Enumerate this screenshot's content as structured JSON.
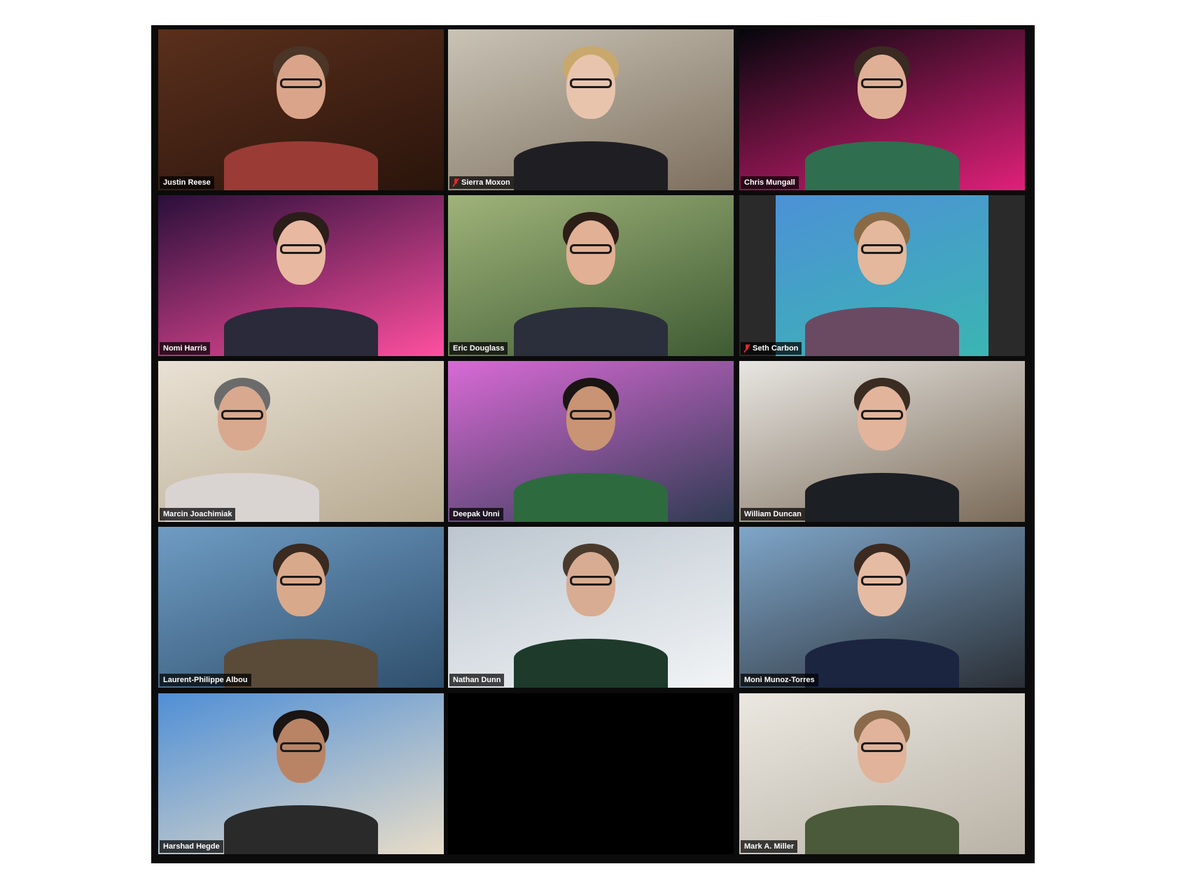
{
  "window": {
    "app": "video-conference-gallery-view"
  },
  "participants": [
    {
      "name": "Justin Reese",
      "muted": false,
      "background": "coffee-beans",
      "colors": {
        "bg1": "#5a2f1c",
        "bg2": "#2a140b",
        "shirt": "#9a3b36",
        "skin": "#d9a48a",
        "hair": "#4a3526"
      }
    },
    {
      "name": "Sierra Moxon",
      "muted": true,
      "background": "desert-outpost",
      "colors": {
        "bg1": "#c9c3b6",
        "bg2": "#7d6f5e",
        "shirt": "#1f1f23",
        "skin": "#e9c4ad",
        "hair": "#c9a86d"
      }
    },
    {
      "name": "Chris Mungall",
      "muted": false,
      "background": "neon-branches",
      "colors": {
        "bg1": "#05060c",
        "bg2": "#e0207a",
        "shirt": "#2f6e4e",
        "skin": "#e0b096",
        "hair": "#3a2a22"
      }
    },
    {
      "name": "Nomi Harris",
      "muted": false,
      "background": "lantern-room",
      "colors": {
        "bg1": "#2a0f3a",
        "bg2": "#ff4fa0",
        "shirt": "#2a2a3a",
        "skin": "#e8b9a0",
        "hair": "#2b1d1a"
      }
    },
    {
      "name": "Eric Douglass",
      "muted": false,
      "background": "punting-river",
      "colors": {
        "bg1": "#9fb37a",
        "bg2": "#3f5b33",
        "shirt": "#2b2f3c",
        "skin": "#e2b094",
        "hair": "#2c1e17"
      }
    },
    {
      "name": "Seth Carbon",
      "muted": true,
      "background": "tropical-sea",
      "colors": {
        "bg1": "#4d8fd8",
        "bg2": "#3ab7b0",
        "shirt": "#6a4a63",
        "skin": "#e3b89d",
        "hair": "#8a6a45",
        "frame": "#2a2a2a"
      }
    },
    {
      "name": "Marcin Joachimiak",
      "muted": false,
      "background": "living-room",
      "colors": {
        "bg1": "#e9e1d4",
        "bg2": "#b6a990",
        "shirt": "#d9d4d2",
        "skin": "#d8a98e",
        "hair": "#6b6b6b"
      }
    },
    {
      "name": "Deepak Unni",
      "muted": false,
      "background": "alpine-village",
      "colors": {
        "bg1": "#d96ad6",
        "bg2": "#2f3b52",
        "shirt": "#2d6b3f",
        "skin": "#c99474",
        "hair": "#1a1412"
      }
    },
    {
      "name": "William Duncan",
      "muted": false,
      "background": "home-office",
      "colors": {
        "bg1": "#e8e6e2",
        "bg2": "#7a6a58",
        "shirt": "#1c1f24",
        "skin": "#e2b49c",
        "hair": "#3b2c22"
      }
    },
    {
      "name": "Laurent-Philippe Albou",
      "muted": false,
      "background": "golden-gate-bridge",
      "colors": {
        "bg1": "#6f9cc4",
        "bg2": "#2f4f6c",
        "shirt": "#5a4a38",
        "skin": "#d9a98c",
        "hair": "#3a2a20"
      }
    },
    {
      "name": "Nathan Dunn",
      "muted": false,
      "background": "ski-slope",
      "colors": {
        "bg1": "#bcc6cf",
        "bg2": "#f2f4f6",
        "shirt": "#1d3a2a",
        "skin": "#d8ac92",
        "hair": "#4a3a2c"
      }
    },
    {
      "name": "Moni Munoz-Torres",
      "muted": false,
      "background": "window-balcony",
      "colors": {
        "bg1": "#7fa6c9",
        "bg2": "#2a2f36",
        "shirt": "#1c2540",
        "skin": "#e6bba3",
        "hair": "#3c2a20"
      }
    },
    {
      "name": "Harshad Hegde",
      "muted": false,
      "background": "palm-beach",
      "colors": {
        "bg1": "#4f8fd6",
        "bg2": "#e8ddc8",
        "shirt": "#2a2a2a",
        "skin": "#b98466",
        "hair": "#1a1412"
      }
    },
    {
      "name": "",
      "muted": false,
      "background": "empty",
      "colors": {
        "bg1": "#000000",
        "bg2": "#000000"
      }
    },
    {
      "name": "Mark A. Miller",
      "muted": false,
      "background": "hallway-wall",
      "colors": {
        "bg1": "#ebe8e1",
        "bg2": "#b9b2a6",
        "shirt": "#4a5a3a",
        "skin": "#e0b39a",
        "hair": "#8a6a4a"
      }
    }
  ]
}
